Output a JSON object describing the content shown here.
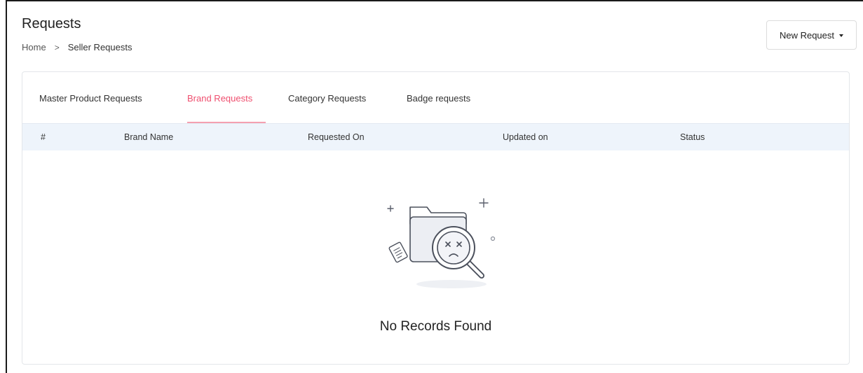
{
  "header": {
    "title": "Requests",
    "breadcrumb": {
      "home": "Home",
      "separator": ">",
      "current": "Seller Requests"
    },
    "new_request_label": "New Request"
  },
  "tabs": [
    {
      "label": "Master Product Requests",
      "active": false
    },
    {
      "label": "Brand Requests",
      "active": true
    },
    {
      "label": "Category Requests",
      "active": false
    },
    {
      "label": "Badge requests",
      "active": false
    }
  ],
  "table": {
    "columns": [
      "#",
      "Brand Name",
      "Requested On",
      "Updated on",
      "Status"
    ],
    "rows": []
  },
  "empty_state": {
    "message": "No Records Found"
  },
  "colors": {
    "accent": "#ef4f6f",
    "table_header_bg": "#eef4fb",
    "border": "#e3e6ea"
  }
}
